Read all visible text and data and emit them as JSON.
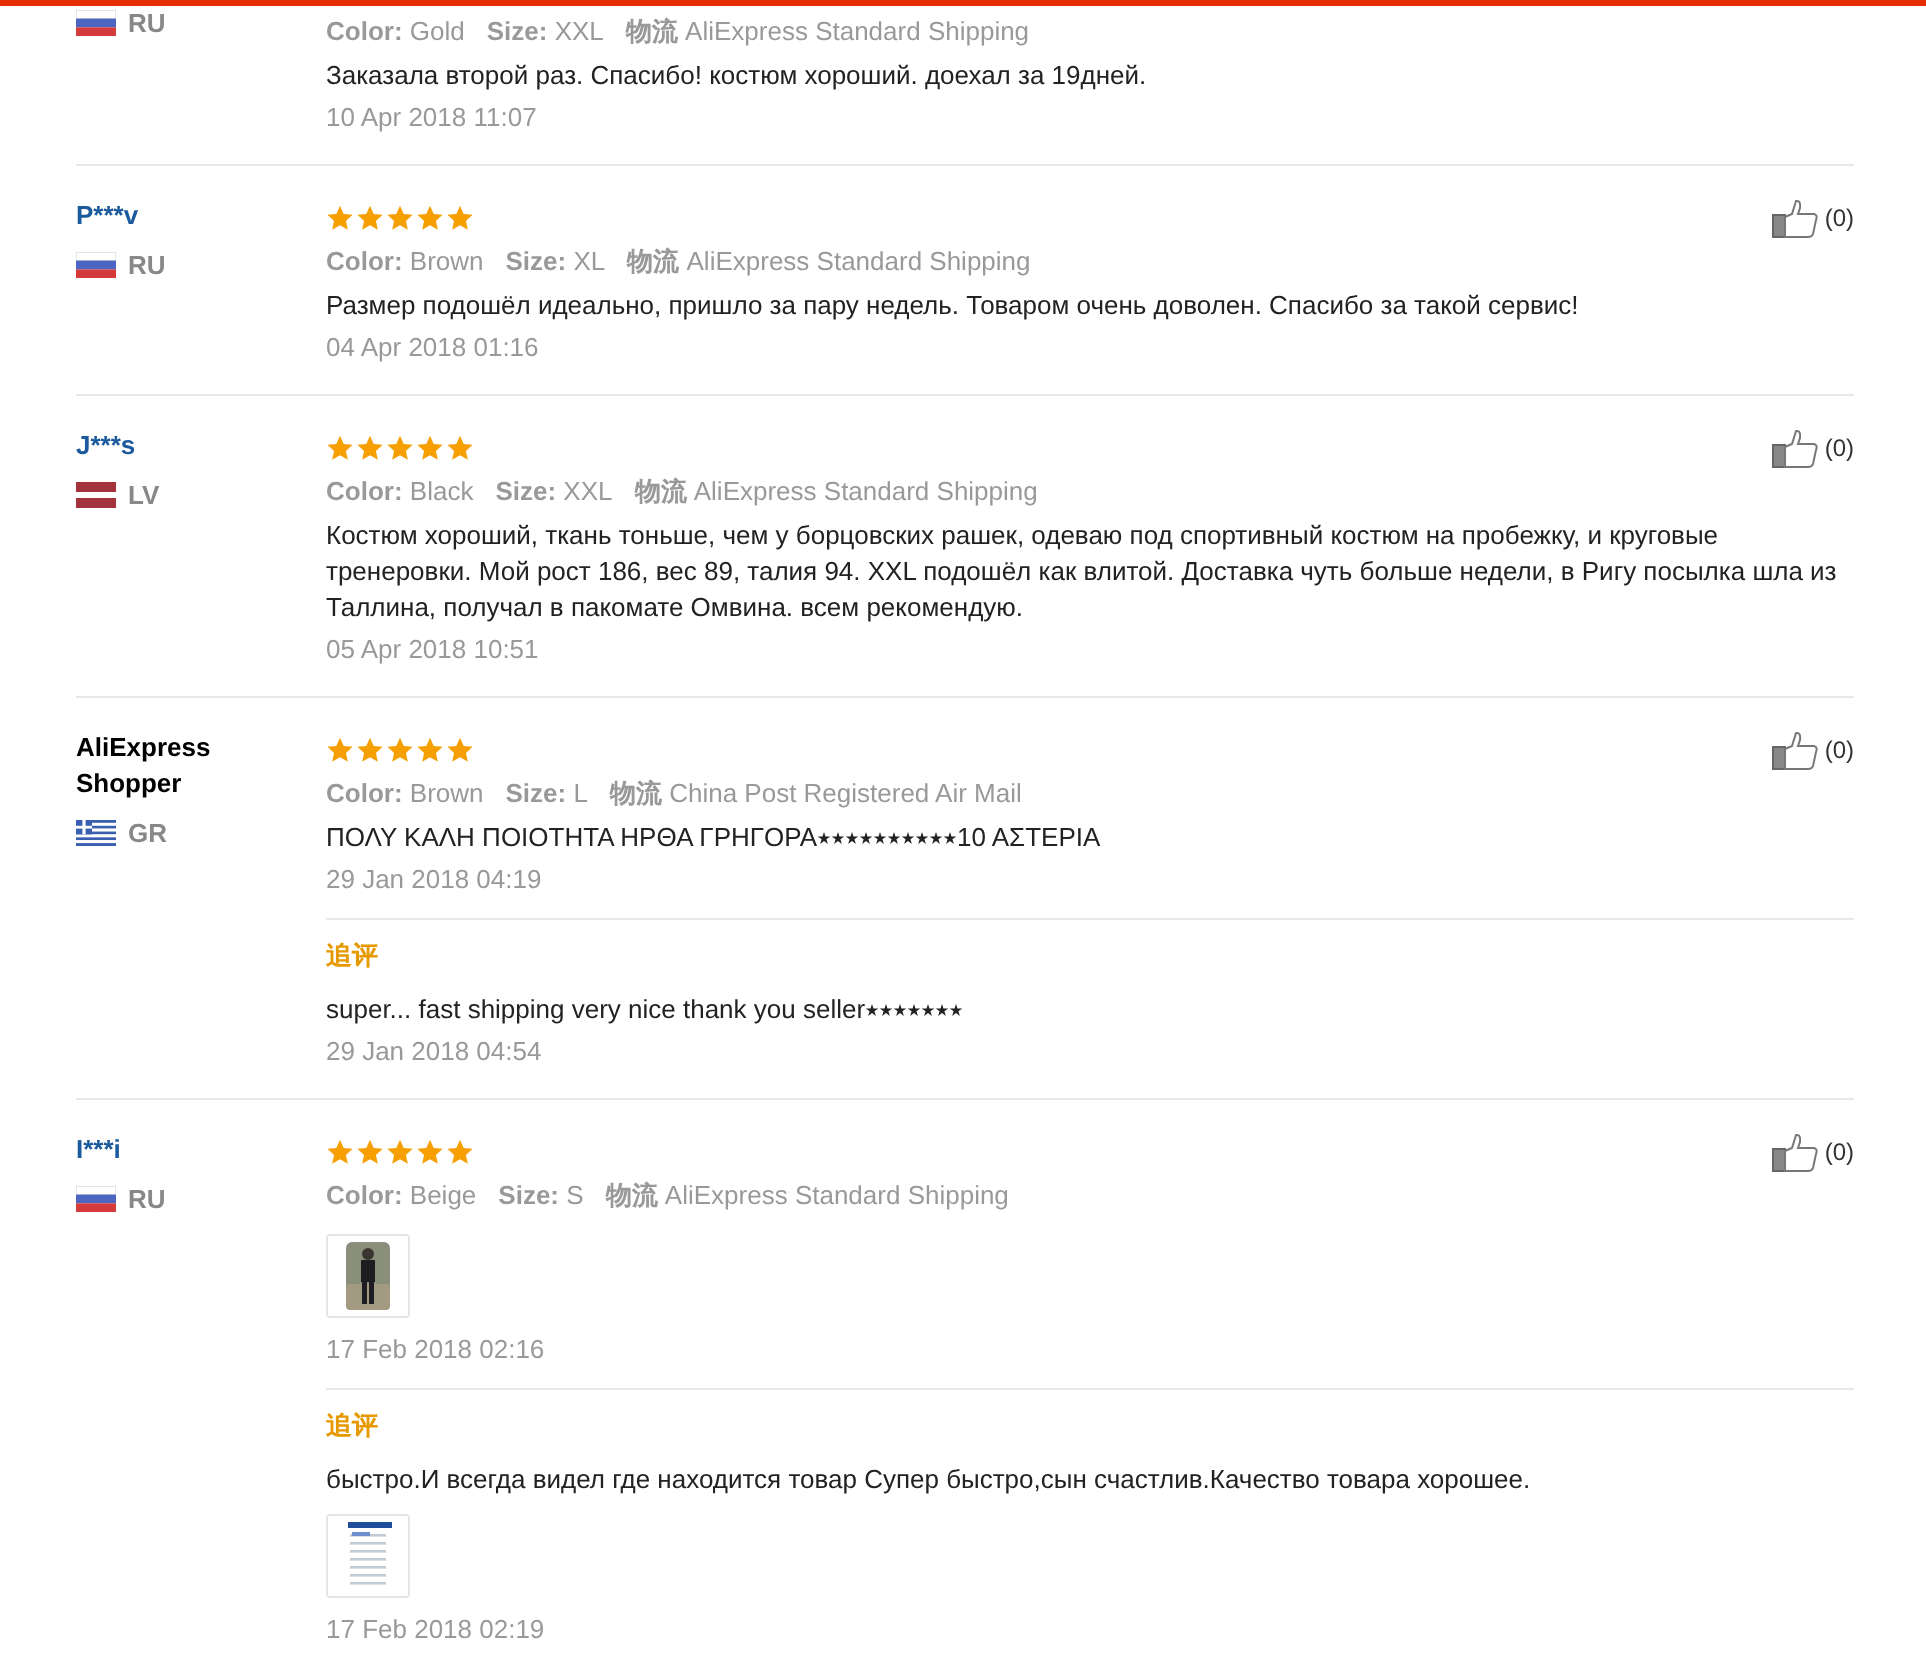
{
  "reviews": [
    {
      "country": "RU",
      "flag": {
        "kind": "ru"
      },
      "meta": {
        "color_label": "Color:",
        "color_name": "Gold",
        "size_label": "Size:",
        "size": "XXL",
        "shipping_label": "物流",
        "shipping": "AliExpress Standard Shipping"
      },
      "text": "Заказала второй раз. Спасибо! костюм хороший. доехал за 19дней.",
      "date": "10 Apr 2018 11:07"
    },
    {
      "author": {
        "name": "P***v",
        "kind": "buyer"
      },
      "country": "RU",
      "flag": {
        "kind": "ru"
      },
      "stars": 5,
      "likes": "(0)",
      "meta": {
        "color_label": "Color:",
        "color_name": "Brown",
        "size_label": "Size:",
        "size": "XL",
        "shipping_label": "物流",
        "shipping": "AliExpress Standard Shipping"
      },
      "text": "Размер подошёл идеально, пришло за пару недель. Товаром очень доволен. Спасибо за такой сервис!",
      "date": "04 Apr 2018 01:16"
    },
    {
      "author": {
        "name": "J***s",
        "kind": "buyer"
      },
      "country": "LV",
      "flag": {
        "kind": "lv"
      },
      "stars": 5,
      "likes": "(0)",
      "meta": {
        "color_label": "Color:",
        "color_name": "Black",
        "size_label": "Size:",
        "size": "XXL",
        "shipping_label": "物流",
        "shipping": "AliExpress Standard Shipping"
      },
      "text": "Костюм хороший, ткань тоньше, чем у борцовских рашек, одеваю под спортивный костюм на пробежку, и круговые тренеровки. Мой рост 186, вес 89, талия 94. XXL подошёл как влитой. Доставка чуть больше недели, в Ригу посылка шла из Таллина, получал в пакомате Омвина. всем рекомендую.",
      "date": "05 Apr 2018 10:51"
    },
    {
      "author": {
        "name": "AliExpress Shopper",
        "kind": "shopper"
      },
      "country": "GR",
      "flag": {
        "kind": "gr"
      },
      "stars": 5,
      "likes": "(0)",
      "meta": {
        "color_label": "Color:",
        "color_name": "Brown",
        "size_label": "Size:",
        "size": "L",
        "shipping_label": "物流",
        "shipping": "China Post Registered Air Mail"
      },
      "text": "ΠΟΛΥ ΚΑΛΗ ΠΟΙΟΤΗΤΑ ΗΡΘΑ ΓΡΗΓΟΡΑ⭑⭑⭑⭑⭑⭑⭑⭑⭑⭑10 ΑΣΤΕΡΙΑ",
      "date": "29 Jan 2018 04:19",
      "followup": {
        "label": "追评",
        "text": "super... fast shipping very nice thank you seller⭑⭑⭑⭑⭑⭑⭑",
        "date": "29 Jan 2018 04:54"
      }
    },
    {
      "author": {
        "name": "I***i",
        "kind": "buyer"
      },
      "country": "RU",
      "flag": {
        "kind": "ru"
      },
      "stars": 5,
      "likes": "(0)",
      "meta": {
        "color_label": "Color:",
        "color_name": "Beige",
        "size_label": "Size:",
        "size": "S",
        "shipping_label": "物流",
        "shipping": "AliExpress Standard Shipping"
      },
      "photos": [
        {
          "kind": "picture"
        }
      ],
      "date": "17 Feb 2018 02:16",
      "followup": {
        "label": "追评",
        "text": "быстро.И всегда видел где находится товар Супер быстро,сын счастлив.Качество товара хорошее.",
        "photos": [
          {
            "kind": "screenshot"
          }
        ],
        "date": "17 Feb 2018 02:19"
      }
    }
  ]
}
